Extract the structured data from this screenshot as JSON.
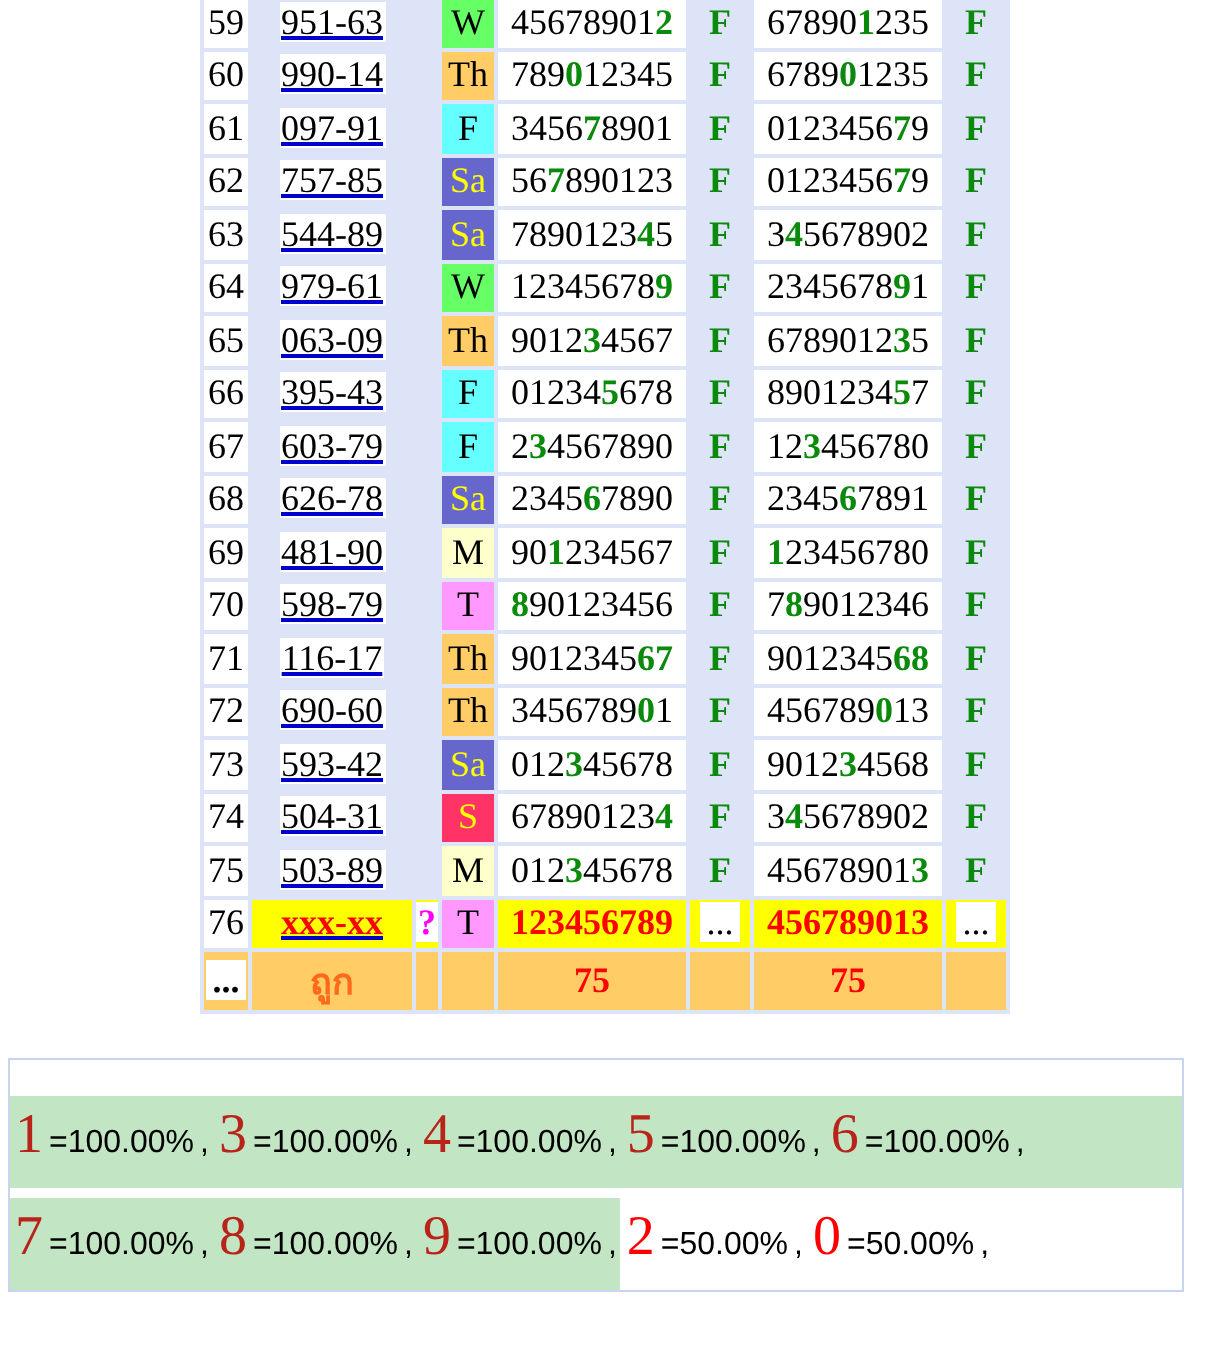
{
  "table": {
    "rows": [
      {
        "kind": "past",
        "num": "59",
        "code": "951-63",
        "day": "W",
        "color": "#66ff66",
        "first": "45678901**2**",
        "result_1": "F",
        "second": "67890**1**235",
        "result_2": "F"
      },
      {
        "kind": "past",
        "num": "60",
        "code": "990-14",
        "day": "Th",
        "color": "#ffcc66",
        "first": "789**0**12345",
        "result_1": "F",
        "second": "6789**0**1235",
        "result_2": "F"
      },
      {
        "kind": "past",
        "num": "61",
        "code": "097-91",
        "day": "F",
        "color": "#66ffff",
        "first": "3456**7**8901",
        "result_1": "F",
        "second": "0123456**7**9",
        "result_2": "F"
      },
      {
        "kind": "past",
        "num": "62",
        "code": "757-85",
        "day": "Sa",
        "color": "#6666cc",
        "first": "56**7**890123",
        "result_1": "F",
        "second": "0123456**7**9",
        "result_2": "F"
      },
      {
        "kind": "past",
        "num": "63",
        "code": "544-89",
        "day": "Sa",
        "color": "#6666cc",
        "first": "7890123**4**5",
        "result_1": "F",
        "second": "3**4**5678902",
        "result_2": "F"
      },
      {
        "kind": "past",
        "num": "64",
        "code": "979-61",
        "day": "W",
        "color": "#66ff66",
        "first": "12345678**9**",
        "result_1": "F",
        "second": "2345678**9**1",
        "result_2": "F"
      },
      {
        "kind": "past",
        "num": "65",
        "code": "063-09",
        "day": "Th",
        "color": "#ffcc66",
        "first": "9012**3**4567",
        "result_1": "F",
        "second": "6789012**3**5",
        "result_2": "F"
      },
      {
        "kind": "past",
        "num": "66",
        "code": "395-43",
        "day": "F",
        "color": "#66ffff",
        "first": "01234**5**678",
        "result_1": "F",
        "second": "8901234**5**7",
        "result_2": "F"
      },
      {
        "kind": "past",
        "num": "67",
        "code": "603-79",
        "day": "F",
        "color": "#66ffff",
        "first": "2**3**4567890",
        "result_1": "F",
        "second": "12**3**456780",
        "result_2": "F"
      },
      {
        "kind": "past",
        "num": "68",
        "code": "626-78",
        "day": "Sa",
        "color": "#6666cc",
        "first": "2345**6**7890",
        "result_1": "F",
        "second": "2345**6**7891",
        "result_2": "F"
      },
      {
        "kind": "past",
        "num": "69",
        "code": "481-90",
        "day": "M",
        "color": "#ffffcc",
        "first": "90**1**234567",
        "result_1": "F",
        "second": "**1**23456780",
        "result_2": "F"
      },
      {
        "kind": "past",
        "num": "70",
        "code": "598-79",
        "day": "T",
        "color": "#ff99ff",
        "first": "**8**90123456",
        "result_1": "F",
        "second": "7**8**9012346",
        "result_2": "F"
      },
      {
        "kind": "past",
        "num": "71",
        "code": "116-17",
        "day": "Th",
        "color": "#ffcc66",
        "first": "9012345**67**",
        "result_1": "F",
        "second": "9012345**68**",
        "result_2": "F"
      },
      {
        "kind": "past",
        "num": "72",
        "code": "690-60",
        "day": "Th",
        "color": "#ffcc66",
        "first": "3456789**0**1",
        "result_1": "F",
        "second": "456789**0**13",
        "result_2": "F"
      },
      {
        "kind": "past",
        "num": "73",
        "code": "593-42",
        "day": "Sa",
        "color": "#6666cc",
        "first": "012**3**45678",
        "result_1": "F",
        "second": "9012**3**4568",
        "result_2": "F"
      },
      {
        "kind": "past",
        "num": "74",
        "code": "504-31",
        "day": "S",
        "color": "#ff3366",
        "first": "67890123**4**",
        "result_1": "F",
        "second": "3**4**5678902",
        "result_2": "F"
      },
      {
        "kind": "past",
        "num": "75",
        "code": "503-89",
        "day": "M",
        "color": "#ffffcc",
        "first": "012**3**45678",
        "result_1": "F",
        "second": "45678901**3**",
        "result_2": "F"
      },
      {
        "kind": "pending",
        "num": "76",
        "code": "xxx-xx",
        "marker": "?",
        "day": "T",
        "color": "#ff99ff",
        "first": "123456789",
        "result_1": "...",
        "second": "456789013",
        "result_2": "..."
      }
    ],
    "footer": {
      "more": "...",
      "label": "ถูก",
      "count_1": "75",
      "count_2": "75"
    }
  },
  "summary": [
    {
      "digit": "1",
      "percent": "=100.00%",
      "separator": ",",
      "highlighted": true
    },
    {
      "digit": "3",
      "percent": "=100.00%",
      "separator": ",",
      "highlighted": true
    },
    {
      "digit": "4",
      "percent": "=100.00%",
      "separator": ",",
      "highlighted": true
    },
    {
      "digit": "5",
      "percent": "=100.00%",
      "separator": ",",
      "highlighted": true
    },
    {
      "digit": "6",
      "percent": "=100.00%",
      "separator": ",",
      "highlighted": true
    },
    {
      "digit": "7",
      "percent": "=100.00%",
      "separator": ",",
      "highlighted": true
    },
    {
      "digit": "8",
      "percent": "=100.00%",
      "separator": ",",
      "highlighted": true
    },
    {
      "digit": "9",
      "percent": "=100.00%",
      "separator": ",",
      "highlighted": true
    },
    {
      "digit": "2",
      "percent": "=50.00%",
      "separator": ",",
      "highlighted": false
    },
    {
      "digit": "0",
      "percent": "=50.00%",
      "separator": ",",
      "highlighted": false
    }
  ]
}
